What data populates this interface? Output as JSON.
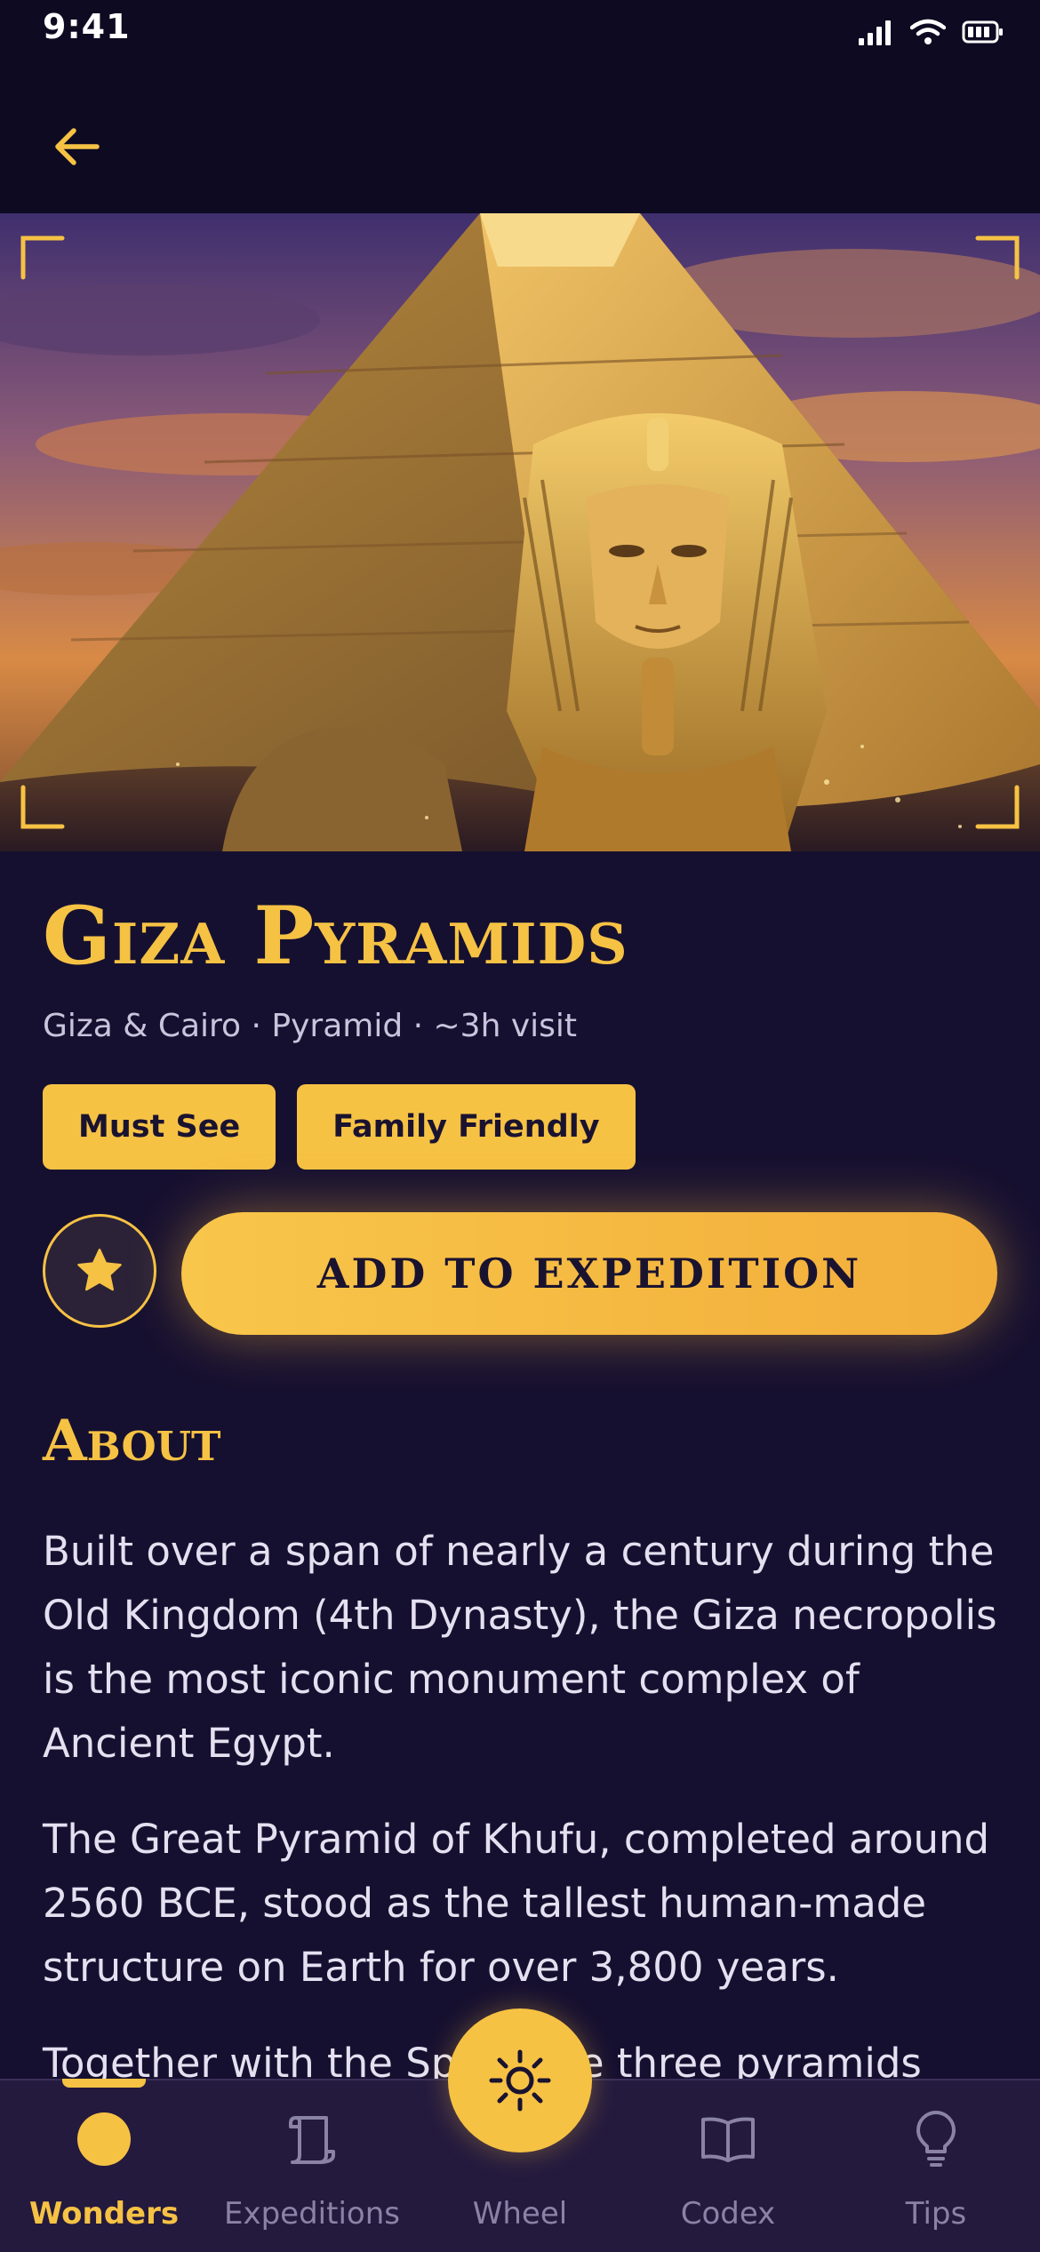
{
  "status": {
    "time": "9:41",
    "icons": [
      "cellular-signal-icon",
      "wifi-icon",
      "battery-icon"
    ]
  },
  "nav": {
    "back_icon": "arrow-left-icon"
  },
  "hero": {
    "image": "pyramid-and-pharaoh-illustration"
  },
  "place": {
    "title": "Giza Pyramids",
    "subtitle": "Giza & Cairo · Pyramid · ~3h visit",
    "tags": [
      "Must See",
      "Family Friendly"
    ]
  },
  "actions": {
    "favorite_icon": "star-icon",
    "add_label": "ADD TO EXPEDITION"
  },
  "about": {
    "heading": "About",
    "paragraphs": [
      "Built over a span of nearly a century during the Old Kingdom (4th Dynasty), the Giza necropolis is the most iconic monument complex of Ancient Egypt.",
      "The Great Pyramid of Khufu, completed around 2560 BCE, stood as the tallest human-made structure on Earth for over 3,800 years.",
      "Together with the Sp",
      "he three pyramids"
    ]
  },
  "tabbar": {
    "items": [
      {
        "label": "Wonders",
        "icon": "circle-icon",
        "active": true
      },
      {
        "label": "Expeditions",
        "icon": "scroll-icon",
        "active": false
      },
      {
        "label": "Wheel",
        "icon": "sun-icon",
        "active": false
      },
      {
        "label": "Codex",
        "icon": "book-icon",
        "active": false
      },
      {
        "label": "Tips",
        "icon": "lightbulb-icon",
        "active": false
      }
    ]
  },
  "colors": {
    "background": "#161030",
    "accent": "#f6c244",
    "nav_background": "#241a3e"
  }
}
